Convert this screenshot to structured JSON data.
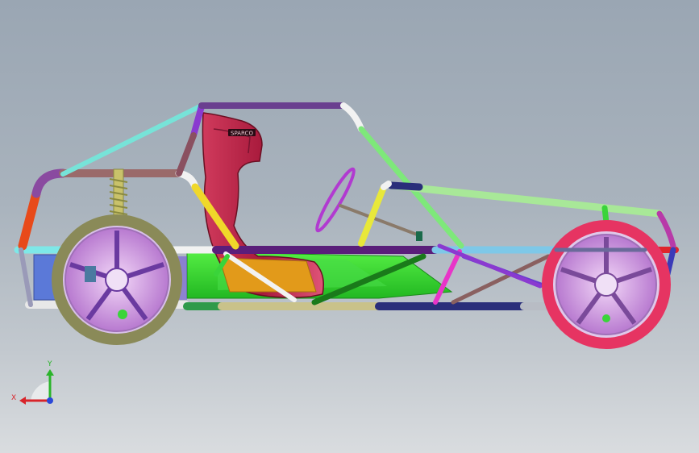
{
  "viewport": {
    "background_top": "#9aa6b3",
    "background_bottom": "#d9dcdf"
  },
  "model": {
    "seat_badge_text": "SPARCO",
    "colors": {
      "roll_hoop_top": "#6a3f8f",
      "roof_front": "#77e3d8",
      "main_rail": "#5a1e7a",
      "rear_rail": "#7de88a",
      "floor_panel": "#2fd62f",
      "seat": "#b01e45",
      "seat_base": "#e0a020",
      "front_wheel_tire": "#8a8a58",
      "front_rim": "#d9a0e8",
      "rear_wheel_tire": "#e63462",
      "rear_rim": "#d9a0e8",
      "spring": "#c9c26a",
      "steering_wheel": "#b13ad0",
      "column_yellow": "#e8e83a"
    }
  },
  "triad": {
    "x_label": "X",
    "y_label": "Y",
    "x_color": "#d8242a",
    "y_color": "#2ab42a",
    "z_color": "#2a48d8"
  }
}
